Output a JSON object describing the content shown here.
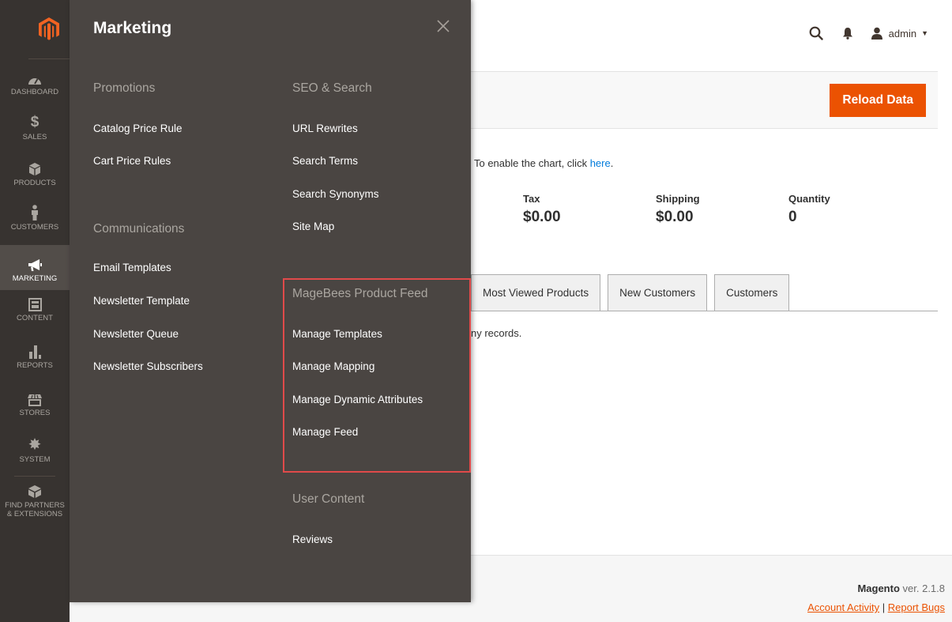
{
  "admin_nav": {
    "items": [
      {
        "label": "Dashboard",
        "icon": "dashboard-icon"
      },
      {
        "label": "Sales",
        "icon": "dollar-icon"
      },
      {
        "label": "Products",
        "icon": "cube-icon"
      },
      {
        "label": "Customers",
        "icon": "person-icon"
      },
      {
        "label": "Marketing",
        "icon": "megaphone-icon"
      },
      {
        "label": "Content",
        "icon": "layout-icon"
      },
      {
        "label": "Reports",
        "icon": "bar-chart-icon"
      },
      {
        "label": "Stores",
        "icon": "storefront-icon"
      },
      {
        "label": "System",
        "icon": "gear-icon"
      },
      {
        "label_line1": "Find Partners",
        "label_line2": "& Extensions",
        "icon": "box-icon"
      }
    ]
  },
  "flyout": {
    "title": "Marketing",
    "promotions": {
      "title": "Promotions",
      "links": [
        "Catalog Price Rule",
        "Cart Price Rules"
      ]
    },
    "communications": {
      "title": "Communications",
      "links": [
        "Email Templates",
        "Newsletter Template",
        "Newsletter Queue",
        "Newsletter Subscribers"
      ]
    },
    "seo": {
      "title": "SEO & Search",
      "links": [
        "URL Rewrites",
        "Search Terms",
        "Search Synonyms",
        "Site Map"
      ]
    },
    "magebees": {
      "title": "MageBees Product Feed",
      "links": [
        "Manage Templates",
        "Manage Mapping",
        "Manage Dynamic Attributes",
        "Manage Feed"
      ]
    },
    "user_content": {
      "title": "User Content",
      "links": [
        "Reviews"
      ]
    }
  },
  "header": {
    "user_name": "admin"
  },
  "page_actions": {
    "reload_label": "Reload Data"
  },
  "dashboard": {
    "chart_note_prefix": ". To enable the chart, click ",
    "chart_note_link": "here",
    "chart_note_suffix": ".",
    "totals": [
      {
        "label": "Tax",
        "value": "$0.00"
      },
      {
        "label": "Shipping",
        "value": "$0.00"
      },
      {
        "label": "Quantity",
        "value": "0"
      }
    ],
    "tabs": [
      "Most Viewed Products",
      "New Customers",
      "Customers"
    ],
    "no_records": "ny records."
  },
  "footer": {
    "brand": "Magento",
    "version": " ver. 2.1.8",
    "account_activity": "Account Activity",
    "separator": " | ",
    "report_bugs": "Report Bugs"
  },
  "colors": {
    "sidebar_bg": "#373330",
    "flyout_bg": "#4a4542",
    "accent": "#eb5202",
    "highlight_border": "#e04a4a",
    "link": "#007bdb"
  }
}
